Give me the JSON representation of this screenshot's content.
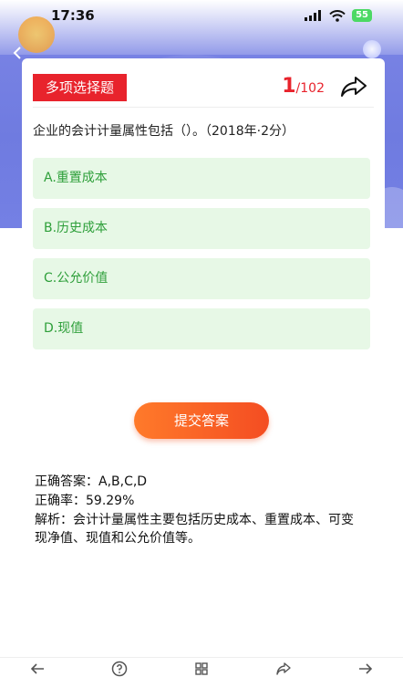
{
  "status_bar": {
    "time": "17:36",
    "battery": "55"
  },
  "question_card": {
    "type_label": "多项选择题",
    "counter_current": "1",
    "counter_total": "/102",
    "question_text": "企业的会计计量属性包括（）。（2018年·2分）",
    "options": [
      {
        "label": "A.重置成本"
      },
      {
        "label": "B.历史成本"
      },
      {
        "label": "C.公允价值"
      },
      {
        "label": "D.现值"
      }
    ]
  },
  "submit_label": "提交答案",
  "answer": {
    "correct": "正确答案：A,B,C,D",
    "rate": "正确率：59.29%",
    "analysis": "解析：会计计量属性主要包括历史成本、重置成本、可变现净值、现值和公允价值等。"
  },
  "colors": {
    "accent": "#e8232c",
    "option_bg": "#e7f8e6",
    "option_text": "#2e9f3a",
    "header_bg": "#7480e4",
    "submit": "#f45a28"
  },
  "icons": {
    "back": "chevron-left-icon",
    "share": "share-arrow-icon",
    "nav_prev": "arrow-left-icon",
    "nav_help": "help-circle-icon",
    "nav_grid": "grid-icon",
    "nav_share": "share-icon",
    "nav_next": "arrow-right-icon"
  }
}
